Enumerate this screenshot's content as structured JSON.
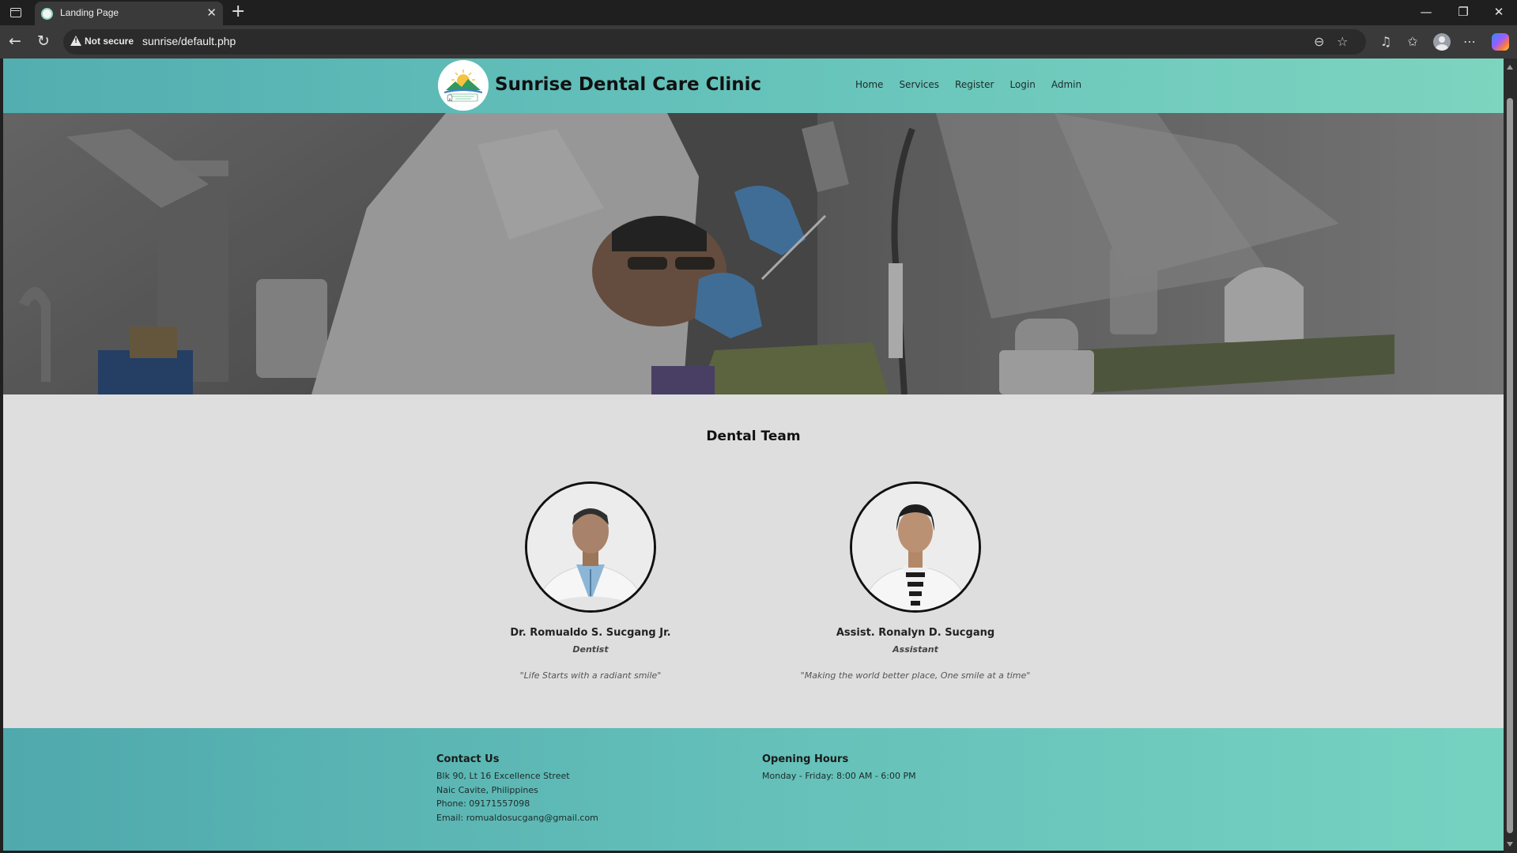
{
  "browser": {
    "tab_title": "Landing Page",
    "tab_close": "✕",
    "new_tab": "+",
    "security_label": "Not secure",
    "url": "sunrise/default.php"
  },
  "site": {
    "brand": "Sunrise Dental Care Clinic",
    "nav": [
      "Home",
      "Services",
      "Register",
      "Login",
      "Admin"
    ]
  },
  "team": {
    "title": "Dental Team",
    "members": [
      {
        "name": "Dr. Romualdo S. Sucgang Jr.",
        "role": "Dentist",
        "quote": "\"Life Starts with a radiant smile\""
      },
      {
        "name": "Assist. Ronalyn D. Sucgang",
        "role": "Assistant",
        "quote": "\"Making the world better place, One smile at a time\""
      }
    ]
  },
  "footer": {
    "contact": {
      "title": "Contact Us",
      "lines": [
        "Blk 90, Lt 16 Excellence Street",
        "Naic Cavite, Philippines",
        "Phone: 09171557098",
        "Email: romualdosucgang@gmail.com"
      ]
    },
    "hours": {
      "title": "Opening Hours",
      "lines": [
        "Monday - Friday: 8:00 AM - 6:00 PM"
      ]
    }
  },
  "colors": {
    "header_start": "#52aeb0",
    "header_end": "#7dd4bf",
    "page_bg": "#dedede"
  }
}
